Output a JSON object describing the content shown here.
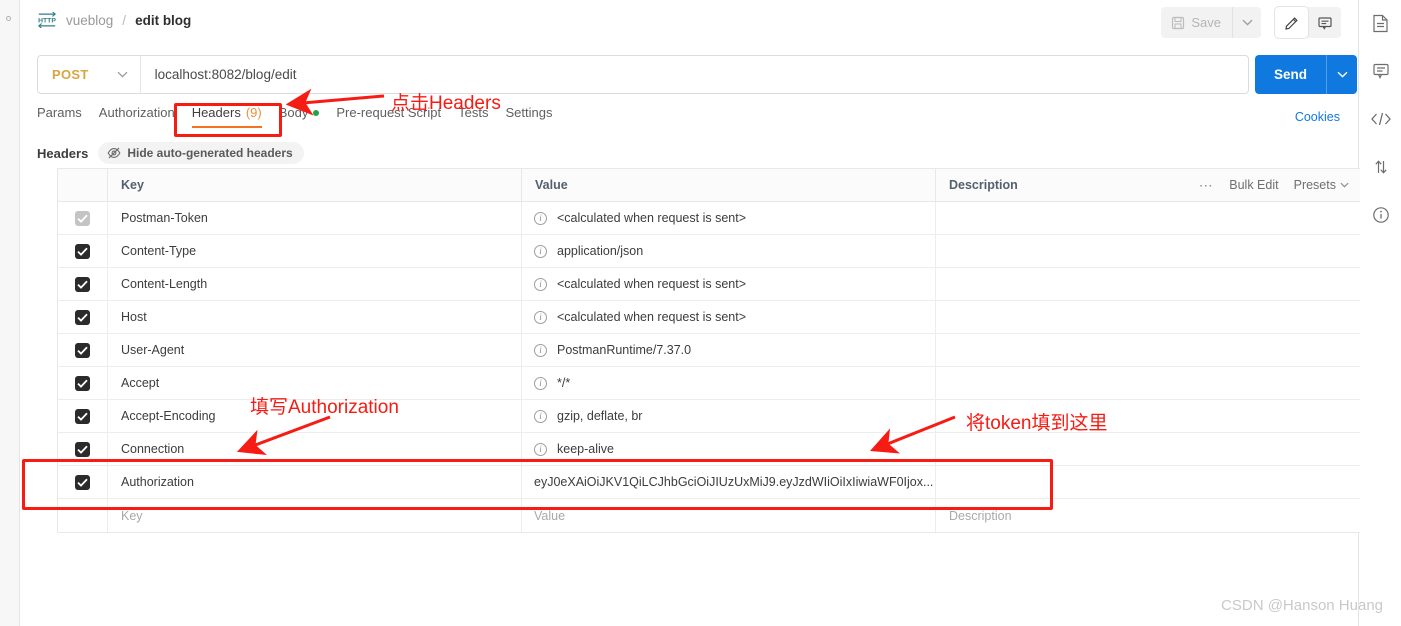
{
  "window": {
    "breadcrumb": {
      "icon": "http-icon",
      "parent": "vueblog",
      "separator": "/",
      "current": "edit blog"
    },
    "toolbar": {
      "save_label": "Save",
      "save_caret_icon": "chevron-down-icon",
      "edit_icon": "pencil-icon",
      "comment_icon": "comment-icon"
    }
  },
  "request": {
    "method": "POST",
    "method_caret_icon": "chevron-down-icon",
    "url": "localhost:8082/blog/edit",
    "send_label": "Send",
    "send_caret_icon": "chevron-down-icon",
    "cookies_label": "Cookies"
  },
  "tabs": [
    {
      "label": "Params",
      "active": false
    },
    {
      "label": "Authorization",
      "active": false
    },
    {
      "label": "Headers",
      "count": "(9)",
      "active": true
    },
    {
      "label": "Body",
      "dot": true,
      "active": false
    },
    {
      "label": "Pre-request Script",
      "active": false
    },
    {
      "label": "Tests",
      "active": false
    },
    {
      "label": "Settings",
      "active": false
    }
  ],
  "headers_panel": {
    "title": "Headers",
    "hide_auto_label": "Hide auto-generated headers",
    "hide_auto_icon": "eye-off-icon",
    "columns": {
      "key": "Key",
      "value": "Value",
      "description": "Description"
    },
    "actions": {
      "more_icon": "ellipsis-icon",
      "bulk_edit": "Bulk Edit",
      "presets": "Presets",
      "presets_caret_icon": "chevron-down-icon"
    },
    "rows": [
      {
        "checked": true,
        "disabled": true,
        "key": "Postman-Token",
        "value": "<calculated when request is sent>",
        "description": "",
        "info_icon": "info-icon"
      },
      {
        "checked": true,
        "disabled": false,
        "key": "Content-Type",
        "value": "application/json",
        "description": "",
        "info_icon": "info-icon"
      },
      {
        "checked": true,
        "disabled": false,
        "key": "Content-Length",
        "value": "<calculated when request is sent>",
        "description": "",
        "info_icon": "info-icon"
      },
      {
        "checked": true,
        "disabled": false,
        "key": "Host",
        "value": "<calculated when request is sent>",
        "description": "",
        "info_icon": "info-icon"
      },
      {
        "checked": true,
        "disabled": false,
        "key": "User-Agent",
        "value": "PostmanRuntime/7.37.0",
        "description": "",
        "info_icon": "info-icon"
      },
      {
        "checked": true,
        "disabled": false,
        "key": "Accept",
        "value": "*/*",
        "description": "",
        "info_icon": "info-icon"
      },
      {
        "checked": true,
        "disabled": false,
        "key": "Accept-Encoding",
        "value": "gzip, deflate, br",
        "description": "",
        "info_icon": "info-icon"
      },
      {
        "checked": true,
        "disabled": false,
        "key": "Connection",
        "value": "keep-alive",
        "description": "",
        "info_icon": "info-icon"
      },
      {
        "checked": true,
        "disabled": false,
        "key": "Authorization",
        "value": "eyJ0eXAiOiJKV1QiLCJhbGciOiJIUzUxMiJ9.eyJzdWIiOiIxIiwiaWF0Ijox...",
        "description": "",
        "info_icon": ""
      }
    ],
    "new_row": {
      "key_placeholder": "Key",
      "value_placeholder": "Value",
      "description_placeholder": "Description"
    }
  },
  "annotations": {
    "color": "#f61b13",
    "click_headers": "点击Headers",
    "fill_authorization": "填写Authorization",
    "put_token_here": "将token填到这里"
  },
  "right_rail": [
    {
      "icon": "document-icon"
    },
    {
      "icon": "comment-icon"
    },
    {
      "icon": "code-icon"
    },
    {
      "icon": "sync-arrows-icon"
    },
    {
      "icon": "info-icon"
    }
  ],
  "watermark": "CSDN @Hanson Huang"
}
